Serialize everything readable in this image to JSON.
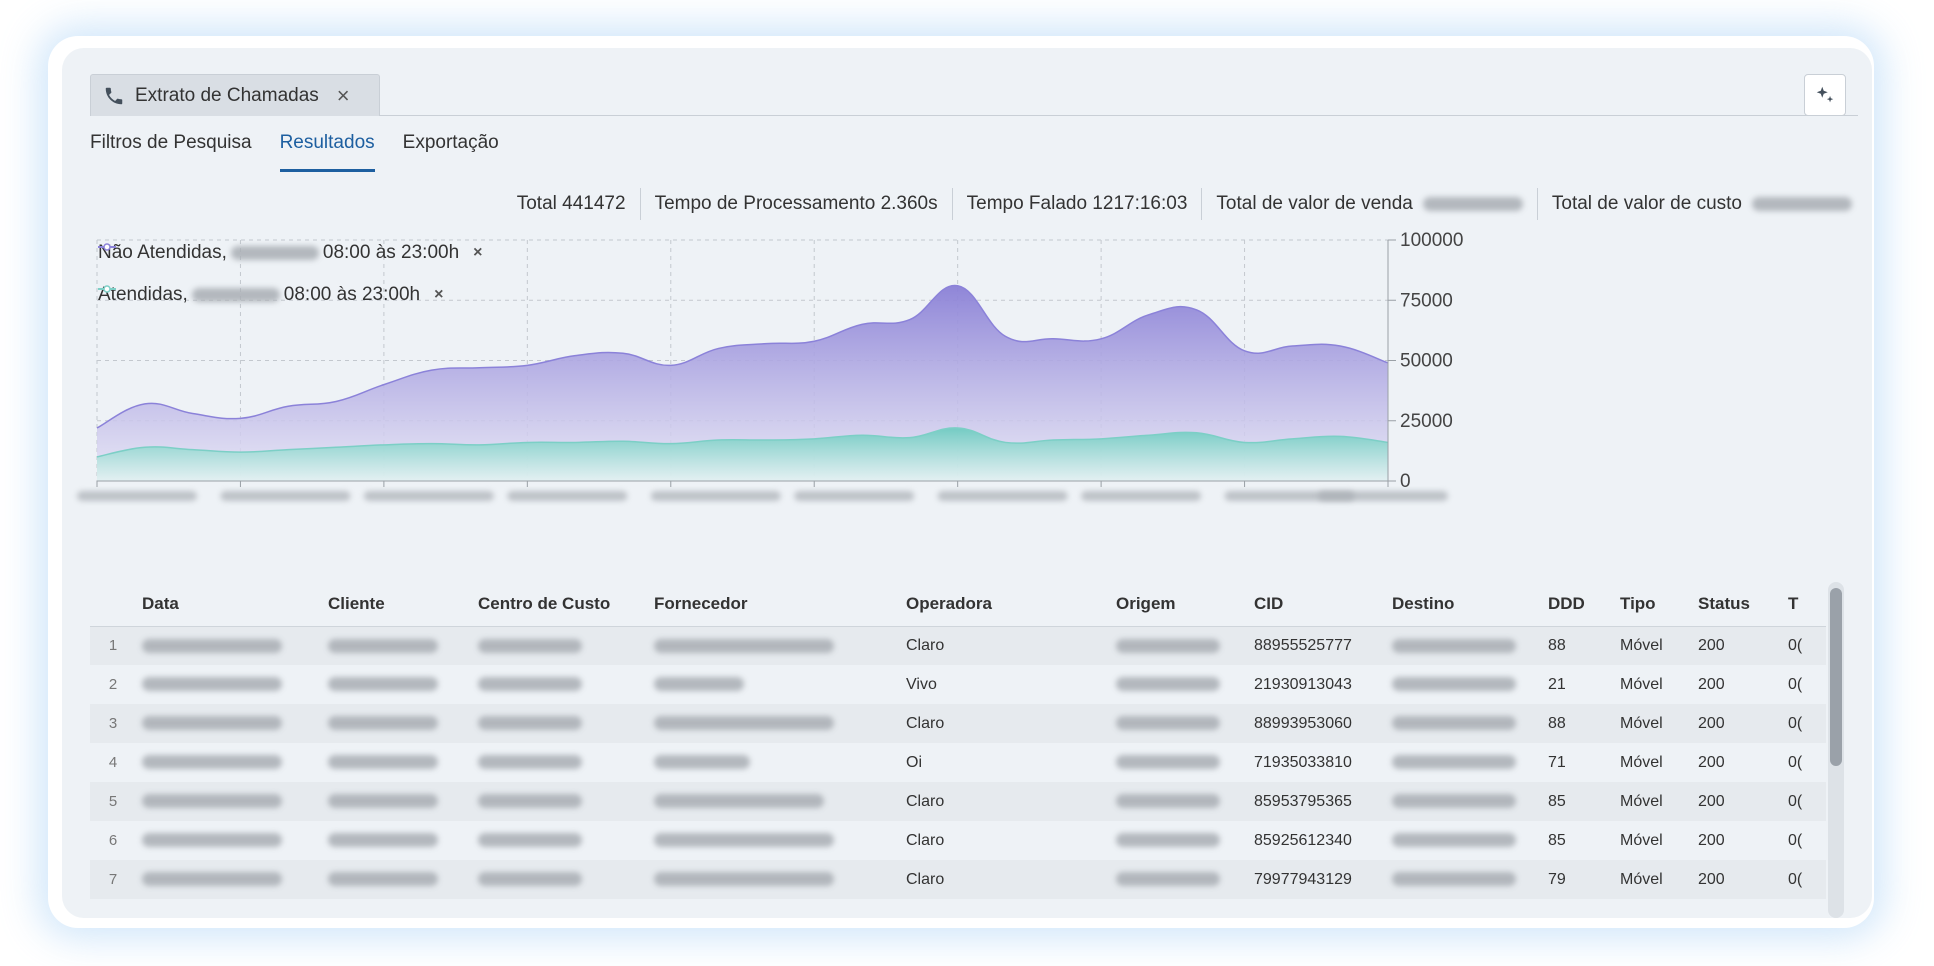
{
  "doc_tab": {
    "icon": "phone-icon",
    "title": "Extrato de Chamadas",
    "close": "×"
  },
  "subtabs": [
    "Filtros de Pesquisa",
    "Resultados",
    "Exportação"
  ],
  "active_subtab": "Resultados",
  "stats": [
    {
      "label": "Total 441472",
      "redacted": false
    },
    {
      "label": "Tempo de Processamento 2.360s",
      "redacted": false
    },
    {
      "label": "Tempo Falado 1217:16:03",
      "redacted": false
    },
    {
      "label": "Total de valor de venda",
      "redacted": true
    },
    {
      "label": "Total de valor de custo",
      "redacted": true
    }
  ],
  "legend": {
    "nao_atendidas": {
      "name": "Não Atendidas,",
      "suffix": "08:00 às 23:00h",
      "close": "×"
    },
    "atendidas": {
      "name": "Atendidas,",
      "suffix": "08:00 às 23:00h",
      "close": "×"
    }
  },
  "chart_data": {
    "type": "area",
    "y_ticks": [
      "100000",
      "75000",
      "50000",
      "25000",
      "0"
    ],
    "ylim": [
      0,
      100000
    ],
    "x_labels_redacted": true,
    "series": [
      {
        "name": "Não Atendidas",
        "color": "#8b82d9",
        "values": [
          22000,
          32000,
          28000,
          26000,
          31000,
          33000,
          40000,
          46000,
          47000,
          48000,
          52000,
          53000,
          48000,
          55000,
          57000,
          58000,
          65000,
          67000,
          81000,
          60000,
          59000,
          59000,
          69000,
          71000,
          54000,
          56000,
          56000,
          49000
        ]
      },
      {
        "name": "Atendidas",
        "color": "#7ccfc6",
        "values": [
          10000,
          14000,
          13000,
          12000,
          13000,
          14000,
          15000,
          15500,
          15000,
          16000,
          16000,
          16500,
          15500,
          17000,
          17000,
          17500,
          19000,
          18000,
          22000,
          16000,
          17000,
          17500,
          19000,
          20000,
          16000,
          17500,
          18500,
          16000
        ]
      }
    ]
  },
  "table": {
    "columns": [
      "Data",
      "Cliente",
      "Centro de Custo",
      "Fornecedor",
      "Operadora",
      "Origem",
      "CID",
      "Destino",
      "DDD",
      "Tipo",
      "Status",
      "T"
    ],
    "rows": [
      {
        "num": "1",
        "operadora": "Claro",
        "cid": "88955525777",
        "ddd": "88",
        "tipo": "Móvel",
        "status": "200",
        "t": "0("
      },
      {
        "num": "2",
        "operadora": "Vivo",
        "cid": "21930913043",
        "ddd": "21",
        "tipo": "Móvel",
        "status": "200",
        "t": "0("
      },
      {
        "num": "3",
        "operadora": "Claro",
        "cid": "88993953060",
        "ddd": "88",
        "tipo": "Móvel",
        "status": "200",
        "t": "0("
      },
      {
        "num": "4",
        "operadora": "Oi",
        "cid": "71935033810",
        "ddd": "71",
        "tipo": "Móvel",
        "status": "200",
        "t": "0("
      },
      {
        "num": "5",
        "operadora": "Claro",
        "cid": "85953795365",
        "ddd": "85",
        "tipo": "Móvel",
        "status": "200",
        "t": "0("
      },
      {
        "num": "6",
        "operadora": "Claro",
        "cid": "85925612340",
        "ddd": "85",
        "tipo": "Móvel",
        "status": "200",
        "t": "0("
      },
      {
        "num": "7",
        "operadora": "Claro",
        "cid": "79977943129",
        "ddd": "79",
        "tipo": "Móvel",
        "status": "200",
        "t": "0("
      }
    ]
  }
}
